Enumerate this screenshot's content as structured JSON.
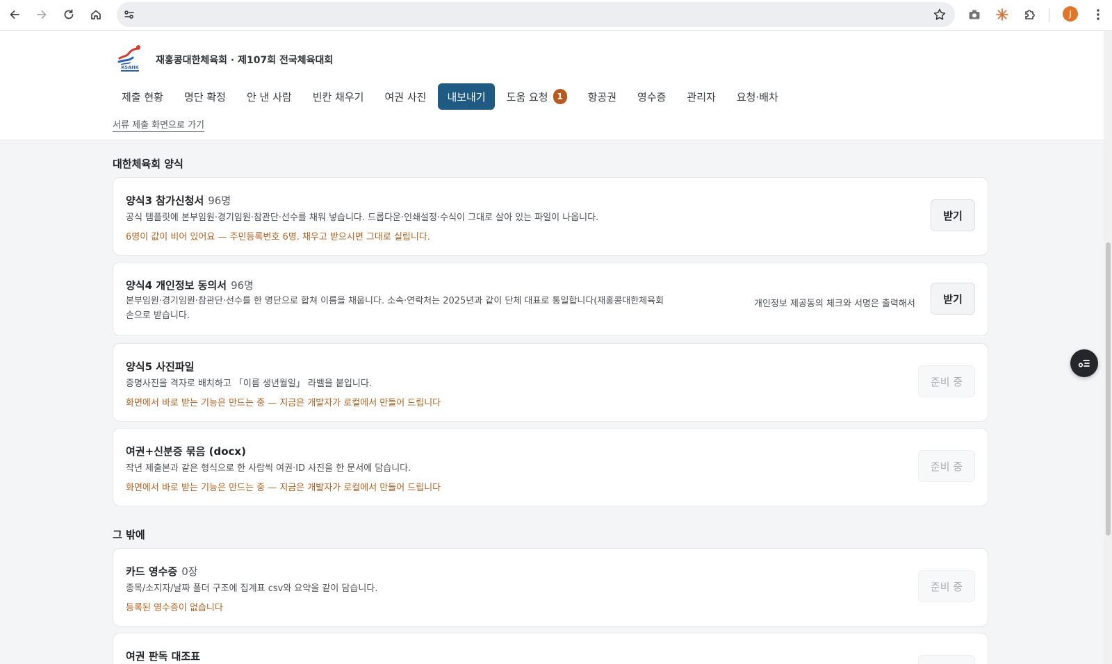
{
  "header": {
    "org_title": "재홍콩대한체육회 · 제107회 전국체육대회",
    "logo_text": "KSAHK",
    "back_link": "서류 제출 화면으로 가기"
  },
  "tabs": [
    {
      "label": "제출 현황"
    },
    {
      "label": "명단 확정"
    },
    {
      "label": "안 낸 사람"
    },
    {
      "label": "빈칸 채우기"
    },
    {
      "label": "여권 사진"
    },
    {
      "label": "내보내기",
      "active": true
    },
    {
      "label": "도움 요청",
      "badge": "1"
    },
    {
      "label": "항공권"
    },
    {
      "label": "영수증"
    },
    {
      "label": "관리자"
    },
    {
      "label": "요청·배차"
    }
  ],
  "sections": [
    {
      "title": "대한체육회 양식",
      "cards": [
        {
          "title": "양식3 참가신청서",
          "count": "96명",
          "desc": "공식 템플릿에 본부임원·경기임원·참관단·선수를 채워 넣습니다. 드롭다운·인쇄설정·수식이 그대로 살아 있는 파일이 나옵니다.",
          "warn": "6명이 값이 비어 있어요 — 주민등록번호 6명. 채우고 받으시면 그대로 실립니다.",
          "button": "받기"
        },
        {
          "title": "양식4 개인정보 동의서",
          "count": "96명",
          "desc": "본부임원·경기임원·참관단·선수를 한 명단으로 합쳐 이름을 채웁니다. 소속·연락처는 2025년과 같이 단체 대표로 통일합니다(재홍콩대한체육회",
          "desc_cont": "손으로 받습니다.",
          "side_note": "개인정보 제공동의 체크와 서명은 출력해서",
          "button": "받기"
        },
        {
          "title": "양식5 사진파일",
          "desc": "증명사진을 격자로 배치하고 「이름 생년월일」 라벨을 붙입니다.",
          "warn": "화면에서 바로 받는 기능은 만드는 중 — 지금은 개발자가 로컬에서 만들어 드립니다",
          "button": "준비 중"
        },
        {
          "title": "여권+신분증 묶음 (docx)",
          "desc": "작년 제출본과 같은 형식으로 한 사람씩 여권·ID 사진을 한 문서에 담습니다.",
          "warn": "화면에서 바로 받는 기능은 만드는 중 — 지금은 개발자가 로컬에서 만들어 드립니다",
          "button": "준비 중"
        }
      ]
    },
    {
      "title": "그 밖에",
      "cards": [
        {
          "title": "카드 영수증",
          "count": "0장",
          "desc": "종목/소지자/날짜 폴더 구조에 집계표 csv와 요약을 같이 담습니다.",
          "warn": "등록된 영수증이 없습니다",
          "button": "준비 중"
        },
        {
          "title": "여권 판독 대조표"
        }
      ]
    }
  ],
  "browser": {
    "profile_initial": "J"
  },
  "colors": {
    "active_tab": "#1e5a82",
    "badge": "#b85a1e",
    "warning_text": "#b3601c",
    "avatar": "#e0762a"
  },
  "icons": [
    "back-arrow-icon",
    "forward-arrow-icon",
    "reload-icon",
    "home-icon",
    "site-settings-icon",
    "bookmark-star-icon",
    "camera-icon",
    "sparkle-extension-icon",
    "puzzle-extensions-icon",
    "more-vert-icon",
    "chat-list-icon"
  ]
}
